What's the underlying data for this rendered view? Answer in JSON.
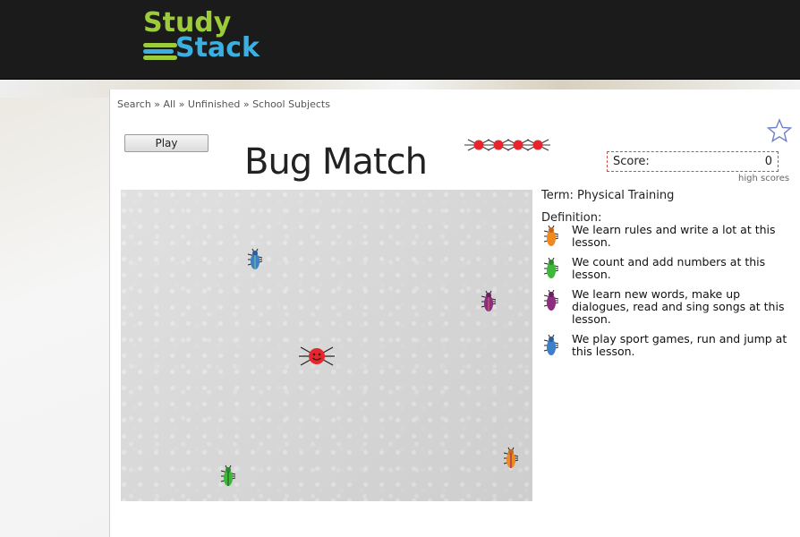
{
  "header": {
    "logo_line1": "Study",
    "logo_line2": "Stack"
  },
  "breadcrumb": {
    "items": [
      "Search",
      "All",
      "Unfinished",
      "School Subjects"
    ],
    "separator": "»"
  },
  "game": {
    "play_label": "Play",
    "title": "Bug Match",
    "score_label": "Score:",
    "score_value": "0",
    "high_scores_label": "high scores",
    "lives_remaining": 4
  },
  "term": {
    "label": "Term",
    "value": "Physical Training"
  },
  "definition": {
    "label": "Definition:",
    "options": [
      {
        "text": "We learn rules and write a lot at this lesson.",
        "bug_color": "orange"
      },
      {
        "text": "We count and add numbers at this lesson.",
        "bug_color": "green"
      },
      {
        "text": "We learn new words, make up dialogues, read and sing songs at this lesson.",
        "bug_color": "purple"
      },
      {
        "text": "We play sport games, run and jump at this lesson.",
        "bug_color": "blue"
      }
    ]
  },
  "field_bugs": [
    {
      "color": "blue"
    },
    {
      "color": "purple"
    },
    {
      "color": "orange"
    },
    {
      "color": "green"
    }
  ],
  "colors": {
    "header_bg": "#1b1b1b",
    "logo_green": "#9ccc3a",
    "logo_blue": "#3ab0e2",
    "score_border": "#d24b4b",
    "spider_red": "#e8252c",
    "star_blue": "#6f7fc6"
  },
  "icons": {
    "favorite": "star-icon",
    "player": "spider-icon",
    "lives": "spider-icon"
  }
}
